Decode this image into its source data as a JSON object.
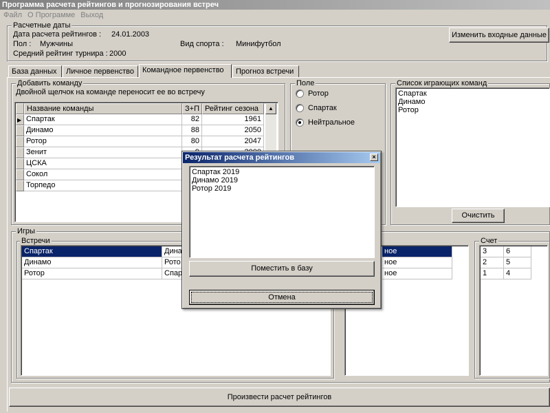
{
  "window": {
    "title": "Программа расчета рейтингов и прогнозирования встреч"
  },
  "menu": [
    "Файл",
    "О Программе",
    "Выход"
  ],
  "dates": {
    "group_label": "Расчетные даты",
    "date_label": "Дата расчета рейтингов :",
    "date_value": "24.01.2003",
    "gender_label": "Пол :",
    "gender_value": "Мужчины",
    "avg_label": "Средний рейтинг турнира :",
    "avg_value": "2000",
    "sport_label": "Вид спорта :",
    "sport_value": "Минифутбол",
    "change_button": "Изменить входные данные"
  },
  "tabs": [
    "База данных",
    "Личное первенство",
    "Командное первенство",
    "Прогноз встречи"
  ],
  "active_tab": 2,
  "add_team": {
    "group_label": "Добавить команду",
    "hint": "Двойной щелчок на команде переносит ее во встречу",
    "columns": [
      "Название команды",
      "З+П",
      "Рейтинг сезона"
    ],
    "rows": [
      {
        "name": "Спартак",
        "games": "82",
        "rating": "1961"
      },
      {
        "name": "Динамо",
        "games": "88",
        "rating": "2050"
      },
      {
        "name": "Ротор",
        "games": "80",
        "rating": "2047"
      },
      {
        "name": "Зенит",
        "games": "9",
        "rating": "2000"
      },
      {
        "name": "ЦСКА",
        "games": "",
        "rating": ""
      },
      {
        "name": "Сокол",
        "games": "",
        "rating": ""
      },
      {
        "name": "Торпедо",
        "games": "",
        "rating": ""
      }
    ]
  },
  "field": {
    "group_label": "Поле",
    "options": [
      "Ротор",
      "Спартак",
      "Нейтральное"
    ],
    "selected": 2
  },
  "playing": {
    "group_label": "Список играющих команд",
    "items": [
      "Спартак",
      "Динамо",
      "Ротор"
    ],
    "clear_button": "Очистить"
  },
  "games": {
    "group_label": "Игры",
    "meetings_label": "Встречи",
    "meetings": [
      {
        "home": "Спартак",
        "away": "Дина"
      },
      {
        "home": "Динамо",
        "away": "Рото"
      },
      {
        "home": "Ротор",
        "away": "Спар"
      }
    ],
    "right_list": [
      "ное",
      "ное",
      "ное"
    ],
    "score_label": "Счет",
    "scores": [
      {
        "a": "3",
        "b": "6"
      },
      {
        "a": "2",
        "b": "5"
      },
      {
        "a": "1",
        "b": "4"
      }
    ]
  },
  "calc_button": "Произвести расчет рейтингов",
  "dialog": {
    "title": "Результат расчета рейтингов",
    "close": "×",
    "results": [
      "Спартак  2019",
      "Динамо  2019",
      "Ротор  2019"
    ],
    "place_button": "Поместить в базу",
    "cancel_button": "Отмена"
  }
}
